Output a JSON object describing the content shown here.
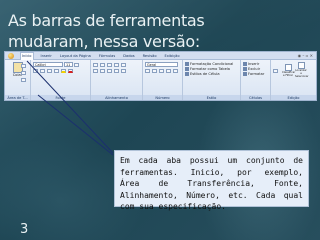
{
  "slide": {
    "title": "As barras de ferramentas mudaram, nessa versão:",
    "page_number": "3",
    "note": "Em cada aba possui um conjunto de ferramentas. Inicio, por exemplo, Área de Transferência, Fonte, Alinhamento, Número, etc. Cada qual com sua especificação."
  },
  "ribbon": {
    "tabs": [
      "Início",
      "Inserir",
      "Layout da Página",
      "Fórmulas",
      "Dados",
      "Revisão",
      "Exibição"
    ],
    "groups": {
      "clipboard": {
        "label": "Área de T...",
        "paste": "Colar"
      },
      "font": {
        "label": "Fonte",
        "font_name": "Calibri",
        "font_size": "11"
      },
      "alignment": {
        "label": "Alinhamento"
      },
      "number": {
        "label": "Número",
        "format": "Geral"
      },
      "styles": {
        "label": "Estilo",
        "items": [
          "Formatação Condicional",
          "Formatar como Tabela",
          "Estilos de Célula"
        ]
      },
      "cells": {
        "label": "Células",
        "items": [
          "Inserir",
          "Excluir",
          "Formatar"
        ]
      },
      "editing": {
        "label": "Edição",
        "items": [
          "Classificar e Filtrar",
          "Localizar e Selecionar"
        ]
      }
    }
  },
  "colors": {
    "background": "#1e4654",
    "title_text": "#e9f1f3",
    "note_bg": "#e6eef9",
    "callout_line": "#1b2f6e"
  }
}
